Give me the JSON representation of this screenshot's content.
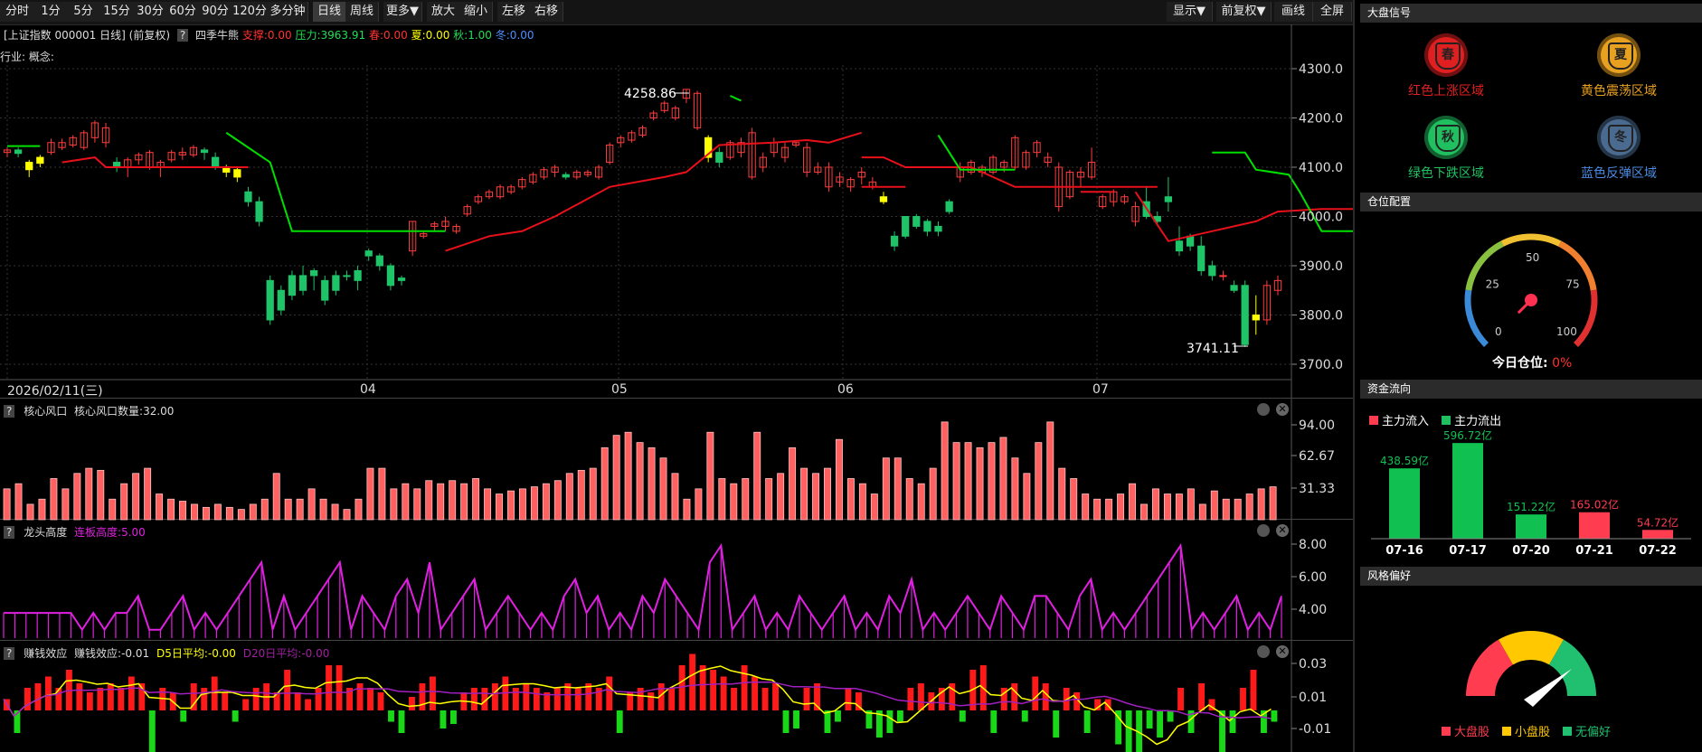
{
  "toolbar": {
    "left_buttons": [
      "分时",
      "1分",
      "5分",
      "15分",
      "30分",
      "60分",
      "90分",
      "120分",
      "多分钟",
      "日线",
      "周线",
      "更多▼",
      "放大",
      "缩小",
      "左移",
      "右移"
    ],
    "active": "日线",
    "right_buttons": [
      "显示▼",
      "前复权▼",
      "画线",
      "全屏"
    ]
  },
  "kline_info": {
    "symbol": "[上证指数 000001 日线]",
    "adjust": "(前复权)",
    "help": "?",
    "indicator_name": "四季牛熊",
    "support_label": "支撑:0.00",
    "pressure_label": "压力:3963.91",
    "spring_label": "春:0.00",
    "summer_label": "夏:0.00",
    "autumn_label": "秋:1.00",
    "winter_label": "冬:0.00",
    "industry_label": "行业: 概念:",
    "high_label": "4258.86",
    "low_label": "3741.11",
    "colors": {
      "up": "#ff3c3c",
      "down": "#1fc468",
      "yellow": "#ffff00",
      "green_line": "#00e000",
      "red_line": "#e8101a"
    }
  },
  "kline_axis": {
    "y_ticks": [
      "4300.0",
      "4200.0",
      "4100.0",
      "4000.0",
      "3900.0",
      "3800.0",
      "3700.0"
    ],
    "date_label": "2026/02/11(三)",
    "x_ticks": [
      "04",
      "05",
      "06",
      "07"
    ]
  },
  "indicator1": {
    "help": "?",
    "name": "核心风口",
    "value_label": "核心风口数量:32.00",
    "y_ticks": [
      "94.00",
      "62.67",
      "31.33"
    ]
  },
  "indicator2": {
    "help": "?",
    "name": "龙头高度",
    "value_label": "连板高度:5.00",
    "y_ticks": [
      "8.00",
      "6.00",
      "4.00"
    ]
  },
  "indicator3": {
    "help": "?",
    "name": "赚钱效应",
    "value_label": "赚钱效应:-0.01",
    "d5_label": "D5日平均:-0.00",
    "d20_label": "D20日平均:-0.00",
    "y_ticks": [
      "0.03",
      "0.01",
      "-0.01"
    ]
  },
  "right_panel": {
    "market_signal": {
      "title": "大盘信号",
      "items": [
        {
          "char": "春",
          "label": "红色上涨区域",
          "color": "#e02020"
        },
        {
          "char": "夏",
          "label": "黄色震荡区域",
          "color": "#e8a020"
        },
        {
          "char": "秋",
          "label": "绿色下跌区域",
          "color": "#20c060"
        },
        {
          "char": "冬",
          "label": "蓝色反弹区域",
          "color": "#4a6a90"
        }
      ]
    },
    "position": {
      "title": "仓位配置",
      "ticks": [
        "0",
        "25",
        "50",
        "75",
        "100"
      ],
      "today_label": "今日仓位:",
      "today_value": "0%",
      "value": 0
    },
    "fund_flow": {
      "title": "资金流向",
      "legend_in": "主力流入",
      "legend_out": "主力流出",
      "chart_data": {
        "type": "bar",
        "categories": [
          "07-16",
          "07-17",
          "07-20",
          "07-21",
          "07-22"
        ],
        "values": [
          438.59,
          596.72,
          151.22,
          165.02,
          54.72
        ],
        "value_labels": [
          "438.59亿",
          "596.72亿",
          "151.22亿",
          "165.02亿",
          "54.72亿"
        ],
        "directions": [
          "out",
          "out",
          "out",
          "in",
          "in"
        ]
      }
    },
    "style": {
      "title": "风格偏好",
      "legend": [
        "大盘股",
        "小盘股",
        "无偏好"
      ],
      "colors": [
        "#ff3c50",
        "#ffc800",
        "#20c070"
      ]
    }
  }
}
